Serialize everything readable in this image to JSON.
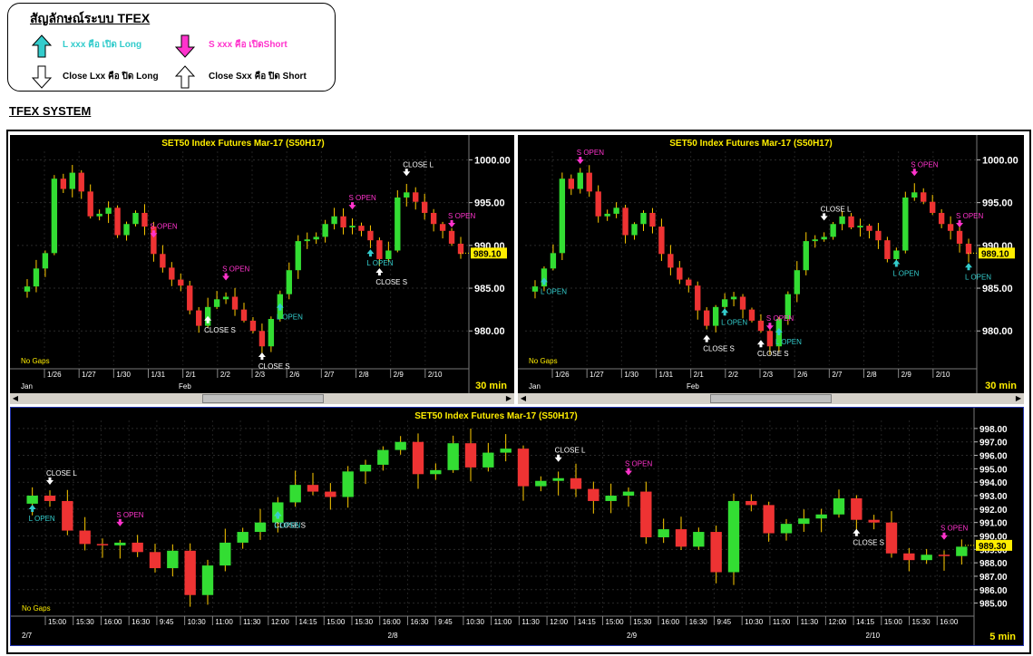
{
  "legend": {
    "title": "สัญลักษณ์ระบบ TFEX",
    "long_open": "L xxx คือ เปิด Long",
    "short_open": "S xxx คือ เปิดShort",
    "close_long": "Close Lxx คือ ปิด Long",
    "close_short": "Close Sxx คือ ปิด Short",
    "colors": {
      "long": "#33cccc",
      "short": "#ff33cc"
    }
  },
  "system_title": "TFEX SYSTEM",
  "chart_data": [
    {
      "type": "candlestick",
      "title": "SET50 Index Futures Mar-17 (S50H17)",
      "timeframe": "30 min",
      "note": "No Gaps",
      "current_price": "989.10",
      "yticks": [
        "1000.00",
        "995.00",
        "990.00",
        "985.00",
        "980.00"
      ],
      "ylim": [
        976,
        1001
      ],
      "xticks": [
        "1/26",
        "1/27",
        "1/30",
        "1/31",
        "2/1",
        "2/2",
        "2/3",
        "2/6",
        "2/7",
        "2/8",
        "2/9",
        "2/10"
      ],
      "months": [
        "Jan",
        "Feb"
      ],
      "close": [
        985.2,
        987.3,
        989.1,
        997.8,
        996.6,
        998.5,
        996.3,
        993.4,
        993.7,
        994.4,
        991.2,
        992.5,
        993.8,
        992.2,
        989.0,
        987.4,
        986.0,
        985.3,
        982.4,
        980.6,
        982.8,
        983.7,
        984.0,
        982.5,
        981.2,
        980.0,
        978.2,
        981.4,
        984.3,
        987.1,
        990.5,
        990.7,
        991.0,
        992.5,
        993.4,
        992.1,
        992.3,
        991.7,
        990.6,
        988.4,
        989.4,
        995.6,
        996.2,
        995.1,
        993.8,
        992.5,
        991.7,
        990.2,
        989.0
      ],
      "signals": [
        {
          "label": "S OPEN",
          "kind": "short",
          "idx": 14
        },
        {
          "label": "CLOSE S",
          "kind": "close_short",
          "idx": 20
        },
        {
          "label": "S OPEN",
          "kind": "short",
          "idx": 22
        },
        {
          "label": "CLOSE S",
          "kind": "close_short",
          "idx": 26
        },
        {
          "label": "L OPEN",
          "kind": "long",
          "idx": 28
        },
        {
          "label": "S OPEN",
          "kind": "short",
          "idx": 36
        },
        {
          "label": "L OPEN",
          "kind": "long",
          "idx": 38
        },
        {
          "label": "CLOSE S",
          "kind": "close_short",
          "idx": 39
        },
        {
          "label": "CLOSE L",
          "kind": "close_long",
          "idx": 42
        },
        {
          "label": "S OPEN",
          "kind": "short",
          "idx": 47
        }
      ]
    },
    {
      "type": "candlestick",
      "title": "SET50 Index Futures Mar-17 (S50H17)",
      "timeframe": "30 min",
      "note": "No Gaps",
      "current_price": "989.10",
      "yticks": [
        "1000.00",
        "995.00",
        "990.00",
        "985.00",
        "980.00"
      ],
      "ylim": [
        976,
        1001
      ],
      "xticks": [
        "1/26",
        "1/27",
        "1/30",
        "1/31",
        "2/1",
        "2/2",
        "2/3",
        "2/6",
        "2/7",
        "2/8",
        "2/9",
        "2/10"
      ],
      "months": [
        "Jan",
        "Feb"
      ],
      "close": [
        985.2,
        987.3,
        989.1,
        997.8,
        996.6,
        998.5,
        996.3,
        993.4,
        993.7,
        994.4,
        991.2,
        992.5,
        993.8,
        992.2,
        989.0,
        987.4,
        986.0,
        985.3,
        982.4,
        980.6,
        982.8,
        983.7,
        984.0,
        982.5,
        981.2,
        980.0,
        978.2,
        981.4,
        984.3,
        987.1,
        990.5,
        990.7,
        991.0,
        992.5,
        993.4,
        992.1,
        992.3,
        991.7,
        990.6,
        988.4,
        989.4,
        995.6,
        996.2,
        995.1,
        993.8,
        992.5,
        991.7,
        990.2,
        989.0
      ],
      "signals": [
        {
          "label": "L OPEN",
          "kind": "long",
          "idx": 1
        },
        {
          "label": "S OPEN",
          "kind": "short",
          "idx": 5
        },
        {
          "label": "CLOSE S",
          "kind": "close_short",
          "idx": 19
        },
        {
          "label": "L OPEN",
          "kind": "long",
          "idx": 21
        },
        {
          "label": "CLOSE S",
          "kind": "close_short",
          "idx": 25
        },
        {
          "label": "S OPEN",
          "kind": "short",
          "idx": 26
        },
        {
          "label": "L OPEN",
          "kind": "long",
          "idx": 27
        },
        {
          "label": "CLOSE L",
          "kind": "close_long",
          "idx": 32
        },
        {
          "label": "L OPEN",
          "kind": "long",
          "idx": 40
        },
        {
          "label": "S OPEN",
          "kind": "short",
          "idx": 42
        },
        {
          "label": "S OPEN",
          "kind": "short",
          "idx": 47
        },
        {
          "label": "L OPEN",
          "kind": "long",
          "idx": 48
        }
      ]
    },
    {
      "type": "candlestick",
      "title": "SET50 Index Futures Mar-17 (S50H17)",
      "timeframe": "5 min",
      "note": "No Gaps",
      "current_price": "989.30",
      "yticks": [
        "998.00",
        "997.00",
        "996.00",
        "995.00",
        "994.00",
        "993.00",
        "992.00",
        "991.00",
        "990.00",
        "989.00",
        "988.00",
        "987.00",
        "986.00",
        "985.00"
      ],
      "ylim": [
        984.3,
        998.6
      ],
      "xticks": [
        "15:00",
        "15:30",
        "16:00",
        "16:30",
        "9:45",
        "10:30",
        "11:00",
        "11:30",
        "12:00",
        "14:15",
        "15:00",
        "15:30",
        "16:00",
        "16:30",
        "9:45",
        "10:30",
        "11:00",
        "11:30",
        "12:00",
        "14:15",
        "15:00",
        "15:30",
        "16:00",
        "16:30",
        "9:45",
        "10:30",
        "11:00",
        "11:30",
        "12:00",
        "14:15",
        "15:00",
        "15:30",
        "16:00"
      ],
      "dates": [
        "2/7",
        "2/8",
        "2/9",
        "2/10"
      ],
      "close": [
        993.0,
        992.6,
        990.4,
        989.4,
        989.3,
        989.5,
        988.8,
        987.6,
        988.9,
        985.6,
        987.8,
        989.5,
        990.3,
        991.0,
        992.5,
        993.8,
        993.3,
        992.9,
        994.8,
        995.3,
        996.4,
        997.0,
        994.6,
        994.9,
        996.9,
        995.1,
        996.2,
        996.5,
        993.7,
        994.1,
        994.3,
        993.5,
        992.6,
        993.0,
        993.3,
        989.9,
        990.5,
        989.2,
        990.3,
        987.3,
        992.6,
        992.3,
        990.2,
        990.9,
        991.3,
        991.6,
        992.8,
        991.2,
        991.0,
        988.7,
        988.2,
        988.6,
        988.5,
        989.2
      ],
      "signals": [
        {
          "label": "CLOSE L",
          "kind": "close_long",
          "idx": 1
        },
        {
          "label": "L OPEN",
          "kind": "long",
          "idx": 0
        },
        {
          "label": "S OPEN",
          "kind": "short",
          "idx": 5
        },
        {
          "label": "CLOSE S",
          "kind": "close_short",
          "idx": 14
        },
        {
          "label": "L OPEN",
          "kind": "long",
          "idx": 14
        },
        {
          "label": "CLOSE L",
          "kind": "close_long",
          "idx": 30
        },
        {
          "label": "S OPEN",
          "kind": "short",
          "idx": 34
        },
        {
          "label": "CLOSE S",
          "kind": "close_short",
          "idx": 47
        },
        {
          "label": "S OPEN",
          "kind": "short",
          "idx": 52
        }
      ]
    }
  ]
}
